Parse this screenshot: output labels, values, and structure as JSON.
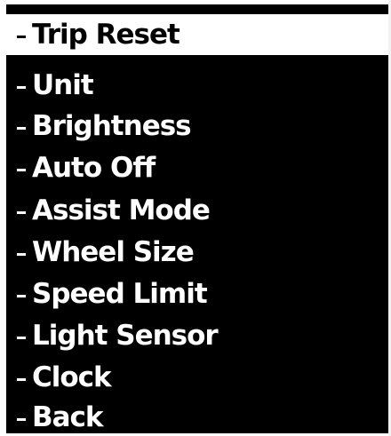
{
  "menu": {
    "items": [
      {
        "label": "Trip Reset",
        "selected": true
      },
      {
        "label": "Unit",
        "selected": false
      },
      {
        "label": "Brightness",
        "selected": false
      },
      {
        "label": "Auto Off",
        "selected": false
      },
      {
        "label": "Assist Mode",
        "selected": false
      },
      {
        "label": "Wheel Size",
        "selected": false
      },
      {
        "label": "Speed Limit",
        "selected": false
      },
      {
        "label": "Light Sensor",
        "selected": false
      },
      {
        "label": "Clock",
        "selected": false
      },
      {
        "label": "Back",
        "selected": false
      }
    ],
    "dash_symbol": "-"
  },
  "colors": {
    "screen_background": "#000000",
    "text": "#ffffff",
    "selected_background": "#ffffff",
    "selected_text": "#000000"
  }
}
